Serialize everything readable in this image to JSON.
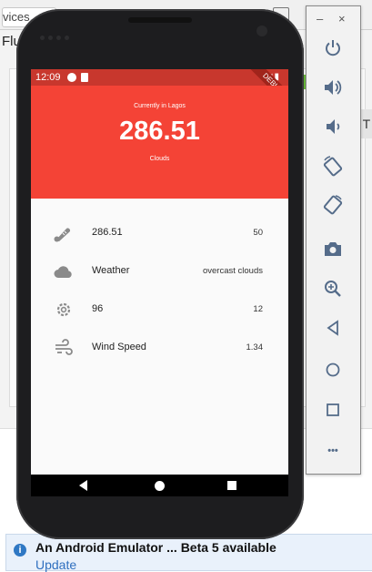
{
  "ide": {
    "device_field": "vices...",
    "title_fragment": "Flu",
    "right_tab": "s T",
    "notice": {
      "title": "An Android Emulator ... Beta 5 available",
      "link": "Update"
    }
  },
  "emulator_toolbar": {
    "minimize": "–",
    "close": "×",
    "buttons": [
      "power-icon",
      "volume-up-icon",
      "volume-down-icon",
      "rotate-left-icon",
      "rotate-right-icon",
      "camera-icon",
      "zoom-icon",
      "back-icon",
      "home-icon",
      "overview-icon",
      "more-icon"
    ],
    "more_label": "•••"
  },
  "device": {
    "status_time": "12:09",
    "debug_banner": "DEBUG"
  },
  "app": {
    "header": {
      "subtitle": "Currently in Lagos",
      "temperature": "286.51",
      "description": "Clouds"
    },
    "rows": [
      {
        "icon": "thermometer-icon",
        "label": "286.51",
        "value": "50"
      },
      {
        "icon": "cloud-icon",
        "label": "Weather",
        "value": "overcast clouds"
      },
      {
        "icon": "gear-icon",
        "label": "96",
        "value": "12"
      },
      {
        "icon": "wind-icon",
        "label": "Wind Speed",
        "value": "1.34"
      }
    ],
    "colors": {
      "header": "#f44336",
      "status_bar": "#c8372d",
      "icon": "#8a8a8a"
    }
  }
}
